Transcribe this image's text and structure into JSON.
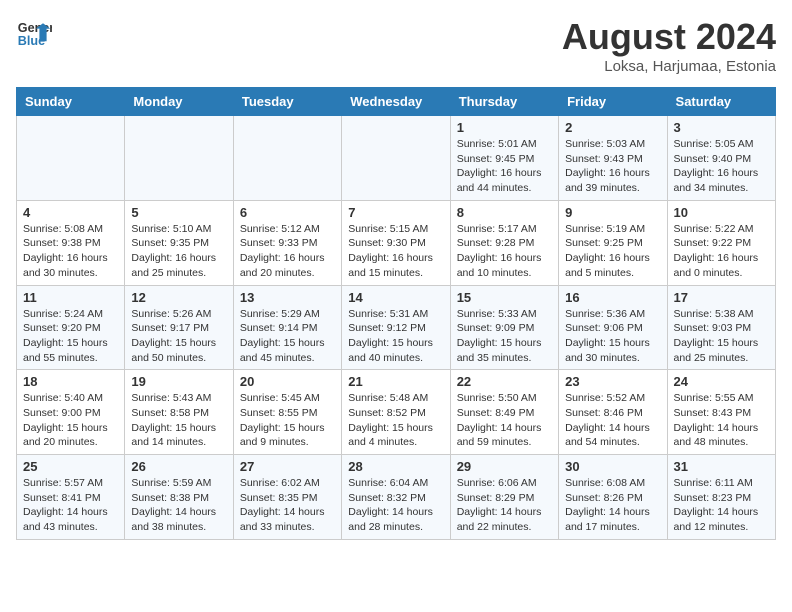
{
  "header": {
    "logo_line1": "General",
    "logo_line2": "Blue",
    "month_year": "August 2024",
    "location": "Loksa, Harjumaa, Estonia"
  },
  "weekdays": [
    "Sunday",
    "Monday",
    "Tuesday",
    "Wednesday",
    "Thursday",
    "Friday",
    "Saturday"
  ],
  "weeks": [
    [
      {
        "day": "",
        "info": ""
      },
      {
        "day": "",
        "info": ""
      },
      {
        "day": "",
        "info": ""
      },
      {
        "day": "",
        "info": ""
      },
      {
        "day": "1",
        "info": "Sunrise: 5:01 AM\nSunset: 9:45 PM\nDaylight: 16 hours\nand 44 minutes."
      },
      {
        "day": "2",
        "info": "Sunrise: 5:03 AM\nSunset: 9:43 PM\nDaylight: 16 hours\nand 39 minutes."
      },
      {
        "day": "3",
        "info": "Sunrise: 5:05 AM\nSunset: 9:40 PM\nDaylight: 16 hours\nand 34 minutes."
      }
    ],
    [
      {
        "day": "4",
        "info": "Sunrise: 5:08 AM\nSunset: 9:38 PM\nDaylight: 16 hours\nand 30 minutes."
      },
      {
        "day": "5",
        "info": "Sunrise: 5:10 AM\nSunset: 9:35 PM\nDaylight: 16 hours\nand 25 minutes."
      },
      {
        "day": "6",
        "info": "Sunrise: 5:12 AM\nSunset: 9:33 PM\nDaylight: 16 hours\nand 20 minutes."
      },
      {
        "day": "7",
        "info": "Sunrise: 5:15 AM\nSunset: 9:30 PM\nDaylight: 16 hours\nand 15 minutes."
      },
      {
        "day": "8",
        "info": "Sunrise: 5:17 AM\nSunset: 9:28 PM\nDaylight: 16 hours\nand 10 minutes."
      },
      {
        "day": "9",
        "info": "Sunrise: 5:19 AM\nSunset: 9:25 PM\nDaylight: 16 hours\nand 5 minutes."
      },
      {
        "day": "10",
        "info": "Sunrise: 5:22 AM\nSunset: 9:22 PM\nDaylight: 16 hours\nand 0 minutes."
      }
    ],
    [
      {
        "day": "11",
        "info": "Sunrise: 5:24 AM\nSunset: 9:20 PM\nDaylight: 15 hours\nand 55 minutes."
      },
      {
        "day": "12",
        "info": "Sunrise: 5:26 AM\nSunset: 9:17 PM\nDaylight: 15 hours\nand 50 minutes."
      },
      {
        "day": "13",
        "info": "Sunrise: 5:29 AM\nSunset: 9:14 PM\nDaylight: 15 hours\nand 45 minutes."
      },
      {
        "day": "14",
        "info": "Sunrise: 5:31 AM\nSunset: 9:12 PM\nDaylight: 15 hours\nand 40 minutes."
      },
      {
        "day": "15",
        "info": "Sunrise: 5:33 AM\nSunset: 9:09 PM\nDaylight: 15 hours\nand 35 minutes."
      },
      {
        "day": "16",
        "info": "Sunrise: 5:36 AM\nSunset: 9:06 PM\nDaylight: 15 hours\nand 30 minutes."
      },
      {
        "day": "17",
        "info": "Sunrise: 5:38 AM\nSunset: 9:03 PM\nDaylight: 15 hours\nand 25 minutes."
      }
    ],
    [
      {
        "day": "18",
        "info": "Sunrise: 5:40 AM\nSunset: 9:00 PM\nDaylight: 15 hours\nand 20 minutes."
      },
      {
        "day": "19",
        "info": "Sunrise: 5:43 AM\nSunset: 8:58 PM\nDaylight: 15 hours\nand 14 minutes."
      },
      {
        "day": "20",
        "info": "Sunrise: 5:45 AM\nSunset: 8:55 PM\nDaylight: 15 hours\nand 9 minutes."
      },
      {
        "day": "21",
        "info": "Sunrise: 5:48 AM\nSunset: 8:52 PM\nDaylight: 15 hours\nand 4 minutes."
      },
      {
        "day": "22",
        "info": "Sunrise: 5:50 AM\nSunset: 8:49 PM\nDaylight: 14 hours\nand 59 minutes."
      },
      {
        "day": "23",
        "info": "Sunrise: 5:52 AM\nSunset: 8:46 PM\nDaylight: 14 hours\nand 54 minutes."
      },
      {
        "day": "24",
        "info": "Sunrise: 5:55 AM\nSunset: 8:43 PM\nDaylight: 14 hours\nand 48 minutes."
      }
    ],
    [
      {
        "day": "25",
        "info": "Sunrise: 5:57 AM\nSunset: 8:41 PM\nDaylight: 14 hours\nand 43 minutes."
      },
      {
        "day": "26",
        "info": "Sunrise: 5:59 AM\nSunset: 8:38 PM\nDaylight: 14 hours\nand 38 minutes."
      },
      {
        "day": "27",
        "info": "Sunrise: 6:02 AM\nSunset: 8:35 PM\nDaylight: 14 hours\nand 33 minutes."
      },
      {
        "day": "28",
        "info": "Sunrise: 6:04 AM\nSunset: 8:32 PM\nDaylight: 14 hours\nand 28 minutes."
      },
      {
        "day": "29",
        "info": "Sunrise: 6:06 AM\nSunset: 8:29 PM\nDaylight: 14 hours\nand 22 minutes."
      },
      {
        "day": "30",
        "info": "Sunrise: 6:08 AM\nSunset: 8:26 PM\nDaylight: 14 hours\nand 17 minutes."
      },
      {
        "day": "31",
        "info": "Sunrise: 6:11 AM\nSunset: 8:23 PM\nDaylight: 14 hours\nand 12 minutes."
      }
    ]
  ]
}
